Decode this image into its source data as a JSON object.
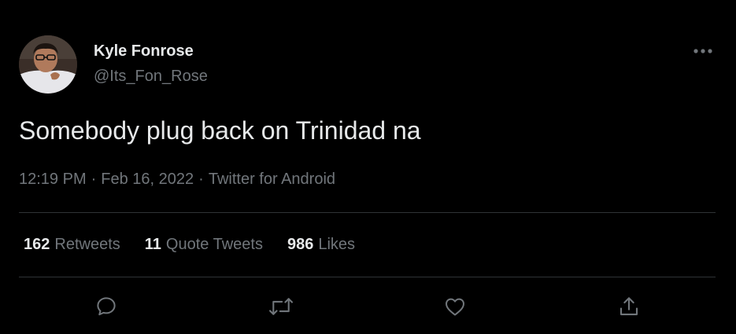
{
  "author": {
    "display_name": "Kyle Fonrose",
    "handle": "@Its_Fon_Rose",
    "avatar_icon": "user-photo"
  },
  "tweet": {
    "text": "Somebody plug back on Trinidad na",
    "time": "12:19 PM",
    "date": "Feb 16, 2022",
    "source": "Twitter for Android",
    "separator": "·"
  },
  "stats": {
    "retweets_count": "162",
    "retweets_label": "Retweets",
    "quote_tweets_count": "11",
    "quote_tweets_label": "Quote Tweets",
    "likes_count": "986",
    "likes_label": "Likes"
  },
  "actions": [
    "reply-icon",
    "retweet-icon",
    "like-icon",
    "share-icon"
  ],
  "theme": {
    "background": "#000000",
    "primary_text": "#e7e9ea",
    "secondary_text": "#71767b",
    "divider": "#2f3336"
  }
}
